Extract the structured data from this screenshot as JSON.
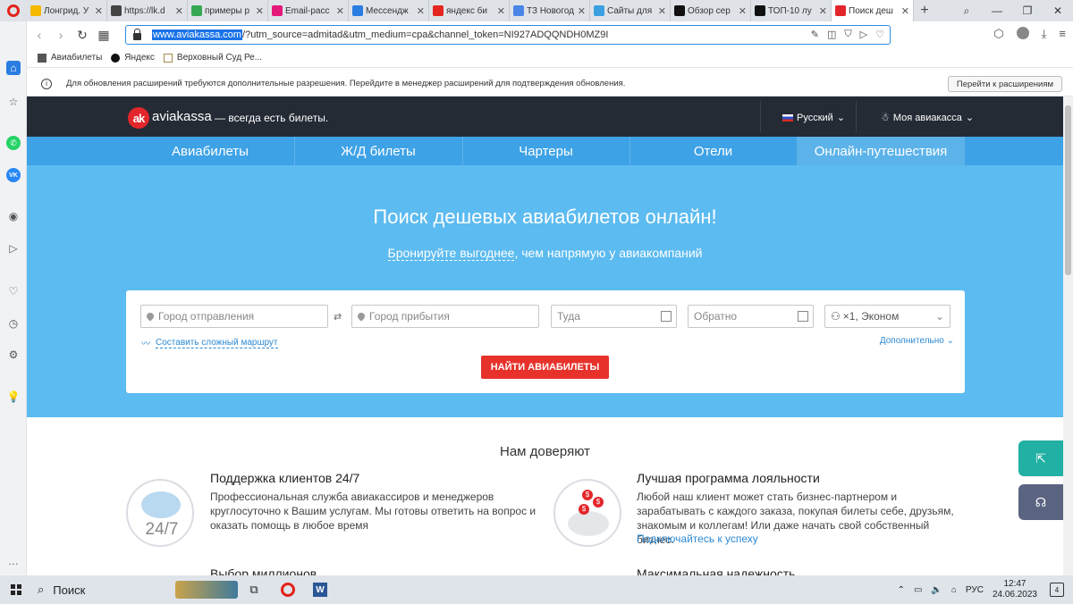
{
  "browser": {
    "tabs": [
      {
        "label": "Лонгрид. У",
        "color": "#f5b800"
      },
      {
        "label": "https://lk.d",
        "color": "#444444"
      },
      {
        "label": "примеры р",
        "color": "#34a853"
      },
      {
        "label": "Email-расс",
        "color": "#e5197a"
      },
      {
        "label": "Мессендж",
        "color": "#2a7de1"
      },
      {
        "label": "яндекс би",
        "color": "#e52620"
      },
      {
        "label": "ТЗ Новогод",
        "color": "#4a86e8"
      },
      {
        "label": "Сайты для",
        "color": "#3aa0e0"
      },
      {
        "label": "Обзор сер",
        "color": "#111111"
      },
      {
        "label": "ТОП-10 лу",
        "color": "#111111"
      },
      {
        "label": "Поиск деш",
        "color": "#e3262b"
      }
    ],
    "url_host": "www.aviakassa.com",
    "url_rest": "/?utm_source=admitad&utm_medium=cpa&channel_token=NI927ADQQNDH0MZ9I",
    "bookmarks": [
      "Авиабилеты",
      "Яндекс",
      "Верховный Суд Ре..."
    ],
    "notice_text": "Для обновления расширений требуются дополнительные разрешения. Перейдите в менеджер расширений для подтверждения обновления.",
    "notice_button": "Перейти к расширениям"
  },
  "site": {
    "logo_mark": "ak",
    "logo_name": "aviakassa",
    "slogan": "— всегда есть билеты.",
    "language": "Русский",
    "account": "Моя авиакасса",
    "nav": [
      "Авиабилеты",
      "Ж/Д билеты",
      "Чартеры",
      "Отели",
      "Онлайн-путешествия"
    ],
    "hero_title": "Поиск дешевых авиабилетов онлайн!",
    "hero_sub_link": "Бронируйте выгоднее",
    "hero_sub_rest": ", чем напрямую у авиакомпаний",
    "search": {
      "from_placeholder": "Город отправления",
      "to_placeholder": "Город прибытия",
      "depart_placeholder": "Туда",
      "return_placeholder": "Обратно",
      "passengers": "×1, Эконом",
      "complex_route": "Составить сложный маршрут",
      "more": "Дополнительно",
      "submit": "НАЙТИ АВИАБИЛЕТЫ"
    },
    "trust_title": "Нам доверяют",
    "features": [
      {
        "title": "Поддержка клиентов 24/7",
        "text": "Профессиональная служба авиакассиров и менеджеров круглосуточно к Вашим услугам. Мы готовы ответить на вопрос и оказать помощь в любое время",
        "icon_text": "24/7"
      },
      {
        "title": "Лучшая программа лояльности",
        "text": "Любой наш клиент может стать бизнес-партнером и зарабатывать с каждого заказа, покупая билеты себе, друзьям, знакомым и коллегам! Или даже начать свой собственный бизнес.",
        "link": "Подключайтесь к успеху"
      },
      {
        "title": "Выбор миллионов"
      },
      {
        "title": "Максимальная надежность"
      }
    ]
  },
  "taskbar": {
    "search_label": "Поиск",
    "lang": "РУС",
    "time": "12:47",
    "date": "24.06.2023",
    "notif_count": "4"
  }
}
